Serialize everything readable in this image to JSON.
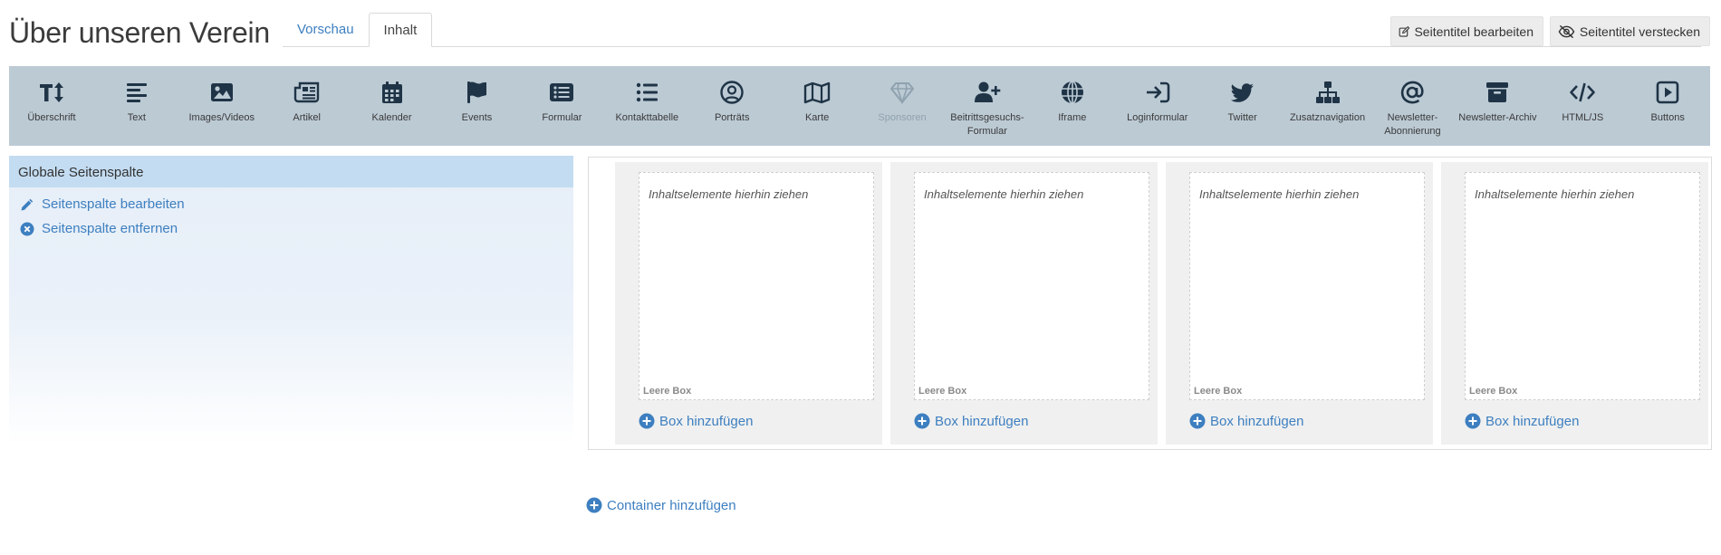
{
  "page": {
    "title": "Über unseren Verein"
  },
  "tabs": {
    "preview": "Vorschau",
    "content": "Inhalt"
  },
  "header_buttons": {
    "edit_title": "Seitentitel bearbeiten",
    "hide_title": "Seitentitel verstecken"
  },
  "toolbar": {
    "items": [
      {
        "label": "Überschrift",
        "icon": "text-height-icon"
      },
      {
        "label": "Text",
        "icon": "align-left-icon"
      },
      {
        "label": "Images/Videos",
        "icon": "image-icon"
      },
      {
        "label": "Artikel",
        "icon": "newspaper-icon"
      },
      {
        "label": "Kalender",
        "icon": "calendar-icon"
      },
      {
        "label": "Events",
        "icon": "flag-icon"
      },
      {
        "label": "Formular",
        "icon": "list-alt-icon"
      },
      {
        "label": "Kontakttabelle",
        "icon": "list-icon"
      },
      {
        "label": "Porträts",
        "icon": "user-circle-icon"
      },
      {
        "label": "Karte",
        "icon": "map-icon"
      },
      {
        "label": "Sponsoren",
        "icon": "gem-icon",
        "disabled": true
      },
      {
        "label": "Beitrittsgesuchs-Formular",
        "icon": "user-plus-icon"
      },
      {
        "label": "Iframe",
        "icon": "globe-icon"
      },
      {
        "label": "Loginformular",
        "icon": "sign-in-icon"
      },
      {
        "label": "Twitter",
        "icon": "twitter-icon"
      },
      {
        "label": "Zusatznavigation",
        "icon": "sitemap-icon"
      },
      {
        "label": "Newsletter-Abonnierung",
        "icon": "at-icon"
      },
      {
        "label": "Newsletter-Archiv",
        "icon": "archive-icon"
      },
      {
        "label": "HTML/JS",
        "icon": "code-icon"
      },
      {
        "label": "Buttons",
        "icon": "play-square-icon"
      }
    ]
  },
  "sidebar": {
    "title": "Globale Seitenspalte",
    "edit_link": "Seitenspalte bearbeiten",
    "remove_link": "Seitenspalte entfernen"
  },
  "container": {
    "columns": [
      {
        "dropzone_text": "Inhaltselemente hierhin ziehen",
        "empty_label": "Leere Box",
        "add_box": "Box hinzufügen"
      },
      {
        "dropzone_text": "Inhaltselemente hierhin ziehen",
        "empty_label": "Leere Box",
        "add_box": "Box hinzufügen"
      },
      {
        "dropzone_text": "Inhaltselemente hierhin ziehen",
        "empty_label": "Leere Box",
        "add_box": "Box hinzufügen"
      },
      {
        "dropzone_text": "Inhaltselemente hierhin ziehen",
        "empty_label": "Leere Box",
        "add_box": "Box hinzufügen"
      }
    ],
    "add_container": "Container hinzufügen"
  },
  "colors": {
    "link": "#3d7fc0",
    "toolbar_bg": "#bccad4",
    "sidebar_head": "#c3dcf1",
    "icon": "#1f3446"
  }
}
